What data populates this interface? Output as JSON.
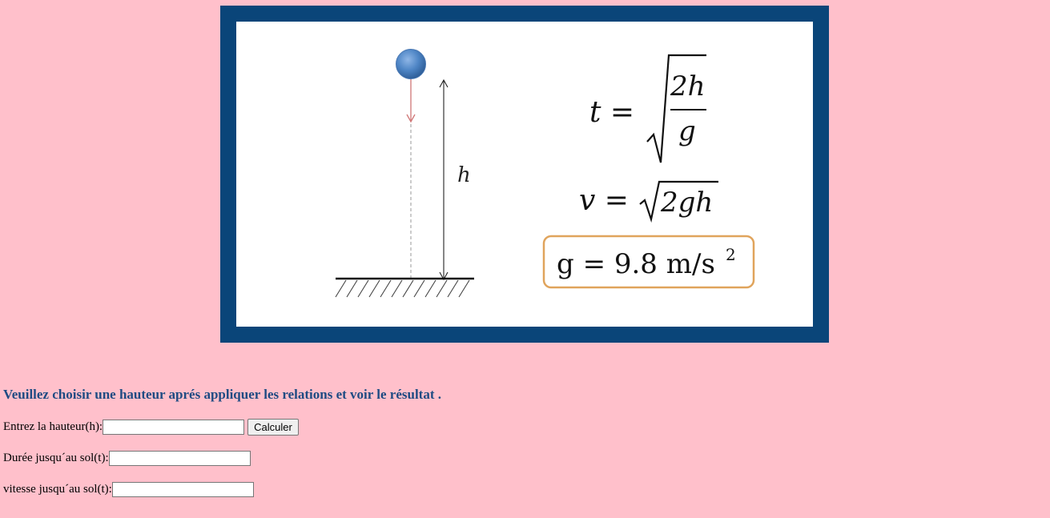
{
  "figure": {
    "labels": {
      "height_symbol": "h"
    },
    "formulas": {
      "time": {
        "lhs": "t =",
        "numerator": "2h",
        "denominator": "g"
      },
      "velocity": {
        "lhs": "v =",
        "radicand": "2gh"
      },
      "gravity": {
        "lhs": "g = 9.8 m/s",
        "exponent": "2"
      }
    },
    "colors": {
      "frame": "#0a4579",
      "ball": "#4f86c6",
      "velocity_arrow": "#d07777",
      "gravity_box_border": "#e0a45c"
    }
  },
  "instruction": "Veuillez choisir une hauteur aprés appliquer les relations et voir le résultat .",
  "form": {
    "height_label": "Entrez la hauteur(h):",
    "height_value": "",
    "calculate_label": "Calculer",
    "time_label": "Durée jusqu´au sol(t):",
    "time_value": "",
    "velocity_label": "vitesse jusqu´au sol(t):",
    "velocity_value": ""
  }
}
